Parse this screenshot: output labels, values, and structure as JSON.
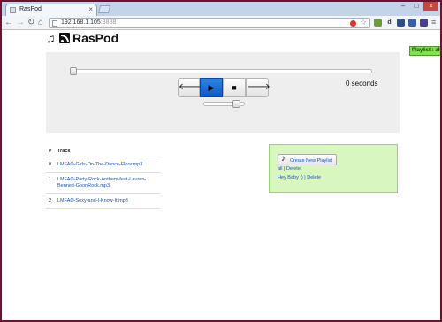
{
  "browser": {
    "tab_title": "RasPod",
    "tab_close": "×",
    "url_host": "192.168.1.105",
    "url_port": ":8888",
    "window_min": "–",
    "window_max": "□",
    "window_close": "×"
  },
  "header": {
    "title": "RasPod",
    "playlist_badge": "Playlist : all"
  },
  "player": {
    "seconds_label": "0 seconds",
    "seek_progress": 0,
    "volume_level": 0.88
  },
  "tracks": {
    "col_num": "#",
    "col_track": "Track",
    "rows": [
      {
        "num": "0",
        "name": "LMFAO-Girls-On-The-Dance-Floor.mp3"
      },
      {
        "num": "1",
        "name": "LMFAO-Party-Rock-Anthem-feat-Lauren-Bennett-GoonRock.mp3"
      },
      {
        "num": "2",
        "name": "LMFAO-Sexy-and-I-Know-It.mp3"
      }
    ]
  },
  "playlists": {
    "create_label": "Create New Playlist",
    "lines": [
      "all | Delete",
      "Hey Baby :) | Delete"
    ]
  },
  "colors": {
    "accent": "#0b57c9",
    "playlist_panel": "#d7f7bf",
    "badge": "#7ee24b",
    "link": "#1a55c9"
  }
}
